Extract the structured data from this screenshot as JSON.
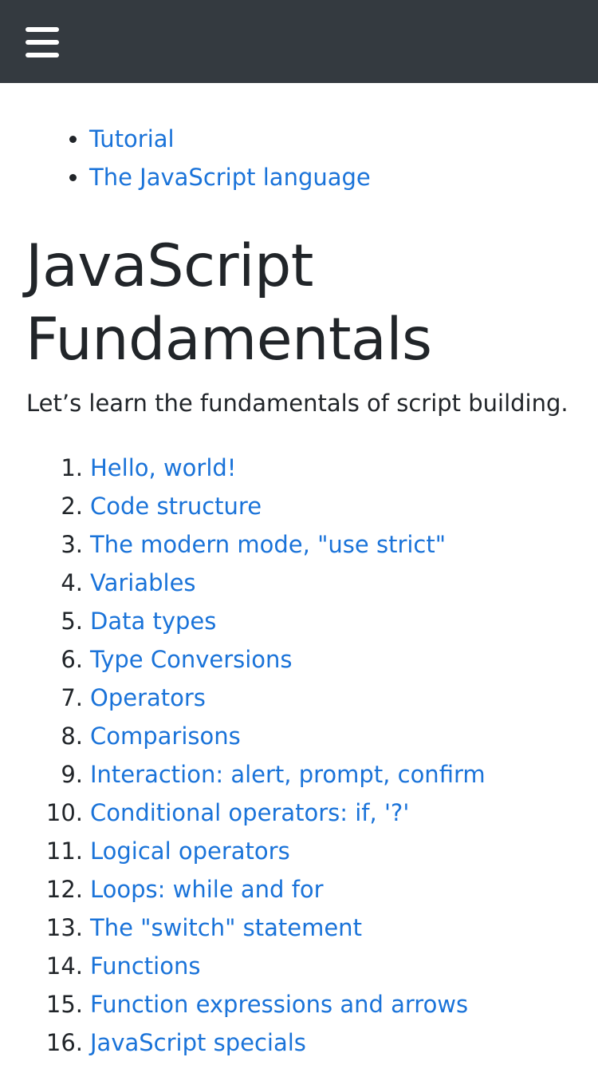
{
  "header": {
    "menu_icon": "hamburger-menu-icon",
    "background": "#343a40"
  },
  "breadcrumb": [
    {
      "label": "Tutorial"
    },
    {
      "label": "The JavaScript language"
    }
  ],
  "page": {
    "title_line1": "JavaScript",
    "title_line2": "Fundamentals",
    "intro": "Let’s learn the fundamentals of script building."
  },
  "chapters": [
    {
      "num": "1.",
      "label": "Hello, world!"
    },
    {
      "num": "2.",
      "label": "Code structure"
    },
    {
      "num": "3.",
      "label": "The modern mode, \"use strict\""
    },
    {
      "num": "4.",
      "label": "Variables"
    },
    {
      "num": "5.",
      "label": "Data types"
    },
    {
      "num": "6.",
      "label": "Type Conversions"
    },
    {
      "num": "7.",
      "label": "Operators"
    },
    {
      "num": "8.",
      "label": "Comparisons"
    },
    {
      "num": "9.",
      "label": "Interaction: alert, prompt, confirm"
    },
    {
      "num": "10.",
      "label": "Conditional operators: if, '?'"
    },
    {
      "num": "11.",
      "label": "Logical operators"
    },
    {
      "num": "12.",
      "label": "Loops: while and for"
    },
    {
      "num": "13.",
      "label": "The \"switch\" statement"
    },
    {
      "num": "14.",
      "label": "Functions"
    },
    {
      "num": "15.",
      "label": "Function expressions and arrows"
    },
    {
      "num": "16.",
      "label": "JavaScript specials"
    }
  ],
  "colors": {
    "link": "#1a73d9",
    "text": "#212529"
  }
}
